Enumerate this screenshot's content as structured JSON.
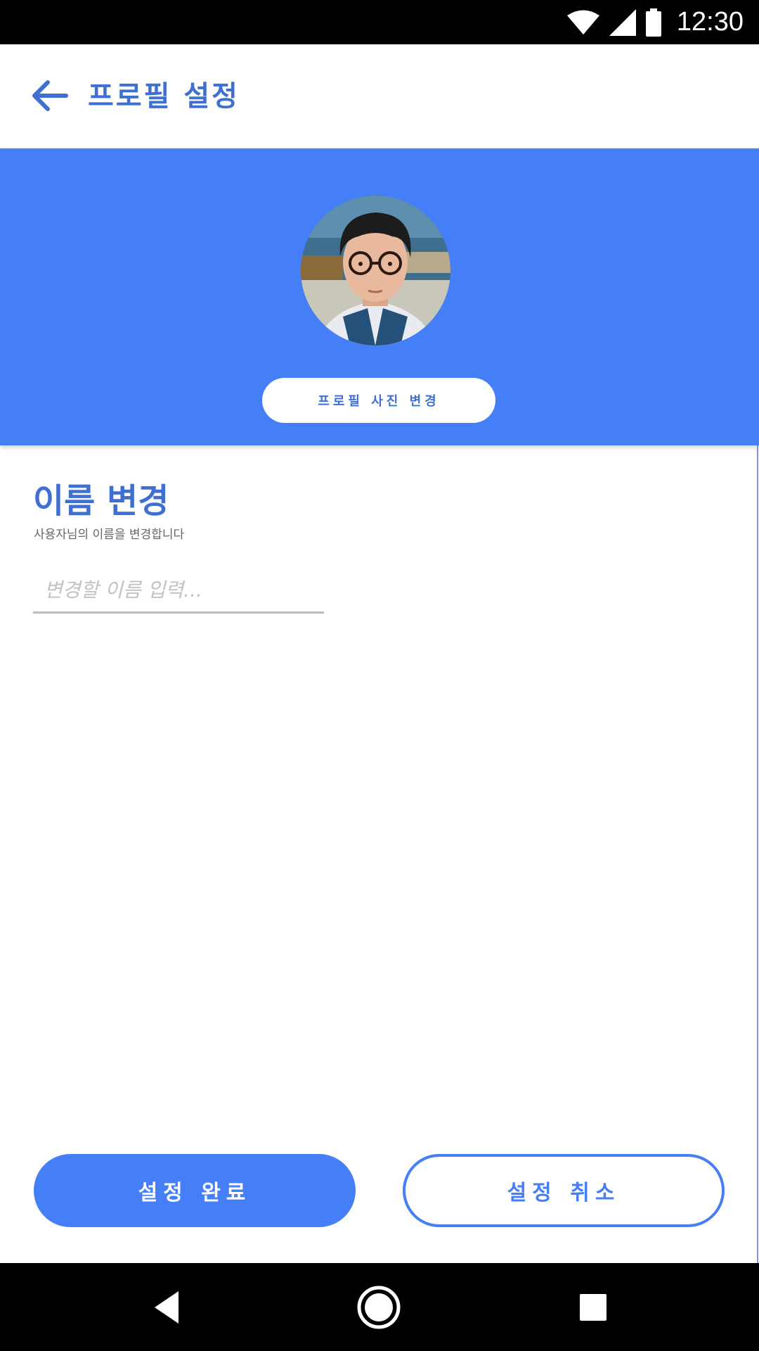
{
  "status_bar": {
    "time": "12:30",
    "icons": [
      "wifi-icon",
      "signal-icon",
      "battery-icon"
    ]
  },
  "header": {
    "title": "프로필 설정",
    "back_icon": "arrow-left-icon"
  },
  "profile": {
    "change_photo_label": "프로필 사진 변경"
  },
  "name_section": {
    "title": "이름 변경",
    "description": "사용자님의 이름을 변경합니다",
    "input_placeholder": "변경할 이름 입력...",
    "input_value": ""
  },
  "actions": {
    "confirm_label": "설정 완료",
    "cancel_label": "설정 취소"
  },
  "nav_bar": {
    "icons": [
      "nav-back-icon",
      "nav-home-icon",
      "nav-recents-icon"
    ]
  },
  "colors": {
    "accent": "#457ff7",
    "title_blue": "#3f6fd0",
    "status_bar": "#000000"
  }
}
